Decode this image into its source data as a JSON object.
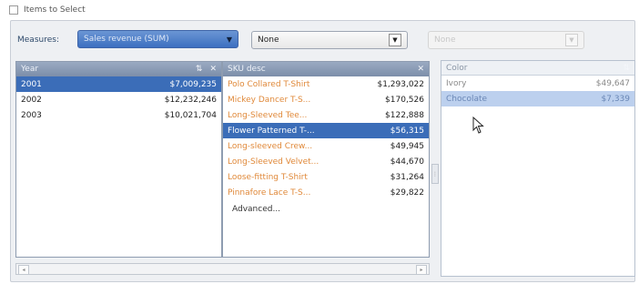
{
  "items_to_select": {
    "label": "Items to Select",
    "checked": false
  },
  "measures": {
    "label": "Measures:",
    "selected": "Sales revenue (SUM)",
    "second_dropdown": "None",
    "third_dropdown": "None"
  },
  "year_panel": {
    "header": "Year",
    "rows": [
      {
        "label": "2001",
        "value": "$7,009,235",
        "selected": true
      },
      {
        "label": "2002",
        "value": "$12,232,246",
        "selected": false
      },
      {
        "label": "2003",
        "value": "$10,021,704",
        "selected": false
      }
    ]
  },
  "skill_panel": {
    "header": "SKU desc",
    "rows": [
      {
        "label": "Polo Collared T-Shirt",
        "value": "$1,293,022",
        "selected": false
      },
      {
        "label": "Mickey Dancer T-S...",
        "value": "$170,526",
        "selected": false
      },
      {
        "label": "Long-Sleeved Tee...",
        "value": "$122,888",
        "selected": false
      },
      {
        "label": "Flower Patterned T-...",
        "value": "$56,315",
        "selected": true
      },
      {
        "label": "Long-sleeved Crew...",
        "value": "$49,945",
        "selected": false
      },
      {
        "label": "Long-Sleeved Velvet...",
        "value": "$44,670",
        "selected": false
      },
      {
        "label": "Loose-fitting T-Shirt",
        "value": "$31,264",
        "selected": false
      },
      {
        "label": "Pinnafore Lace T-S...",
        "value": "$29,822",
        "selected": false
      }
    ],
    "advanced_label": "Advanced..."
  },
  "color_panel": {
    "header": "Color",
    "rows": [
      {
        "label": "Ivory",
        "value": "$49,647",
        "selected": false
      },
      {
        "label": "Chocolate",
        "value": "$7,339",
        "selected": true
      }
    ]
  },
  "icons": {
    "sort": "sort-icon",
    "close": "close-icon",
    "dropdown": "chevron-down-icon",
    "cursor": "mouse-pointer-icon"
  },
  "colors": {
    "header_blue": "#7c8ea9",
    "selection_blue": "#3b6db8",
    "orange_text": "#e0893a"
  }
}
